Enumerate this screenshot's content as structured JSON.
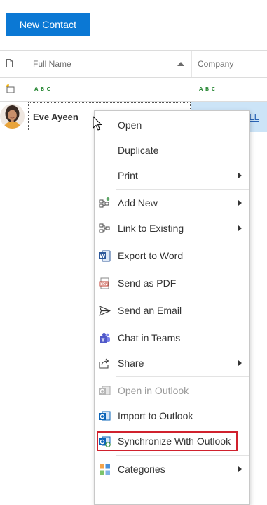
{
  "toolbar": {
    "new_contact_label": "New Contact"
  },
  "grid": {
    "columns": [
      "Full Name",
      "Company"
    ],
    "filter_placeholder_icon": "abc-filter-icon",
    "row": {
      "full_name": "Eve Ayeen",
      "company_partial": "m LL"
    }
  },
  "context_menu": {
    "items": [
      {
        "label": "Open",
        "icon": "",
        "submenu": false,
        "enabled": true
      },
      {
        "label": "Duplicate",
        "icon": "",
        "submenu": false,
        "enabled": true
      },
      {
        "label": "Print",
        "icon": "",
        "submenu": true,
        "enabled": true
      },
      {
        "label": "Add New",
        "icon": "add-new-icon",
        "submenu": true,
        "enabled": true
      },
      {
        "label": "Link to Existing",
        "icon": "link-existing-icon",
        "submenu": true,
        "enabled": true
      },
      {
        "label": "Export to Word",
        "icon": "word-icon",
        "submenu": false,
        "enabled": true
      },
      {
        "label": "Send as PDF",
        "icon": "pdf-icon",
        "submenu": false,
        "enabled": true
      },
      {
        "label": "Send an Email",
        "icon": "send-icon",
        "submenu": false,
        "enabled": true
      },
      {
        "label": "Chat in Teams",
        "icon": "teams-icon",
        "submenu": false,
        "enabled": true
      },
      {
        "label": "Share",
        "icon": "share-icon",
        "submenu": true,
        "enabled": true
      },
      {
        "label": "Open in Outlook",
        "icon": "outlook-icon",
        "submenu": false,
        "enabled": false
      },
      {
        "label": "Import to Outlook",
        "icon": "outlook-import-icon",
        "submenu": false,
        "enabled": true
      },
      {
        "label": "Synchronize With Outlook",
        "icon": "outlook-sync-icon",
        "submenu": false,
        "enabled": true
      },
      {
        "label": "Categories",
        "icon": "categories-icon",
        "submenu": true,
        "enabled": true
      }
    ]
  },
  "colors": {
    "accent": "#0b78d4",
    "selection": "#cce4f7",
    "highlight_box": "#d0212d"
  }
}
